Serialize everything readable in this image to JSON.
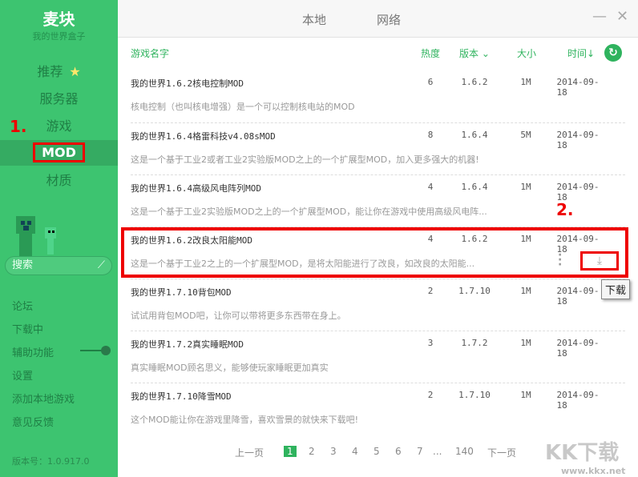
{
  "sidebar": {
    "logo": "麦块",
    "subtitle": "我的世界盒子",
    "nav": [
      "推荐",
      "服务器",
      "游戏",
      "MOD",
      "材质"
    ],
    "annotation1": "1.",
    "search_placeholder": "搜索",
    "links": [
      "论坛",
      "下载中",
      "辅助功能",
      "设置",
      "添加本地游戏",
      "意见反馈"
    ],
    "version": "版本号：1.0.917.0"
  },
  "tabs": [
    "本地",
    "网络"
  ],
  "columns": {
    "name": "游戏名字",
    "heat": "热度",
    "version": "版本",
    "size": "大小",
    "time": "时间"
  },
  "rows": [
    {
      "title": "我的世界1.6.2核电控制MOD",
      "desc": "核电控制（也叫核电增强）是一个可以控制核电站的MOD",
      "heat": "6",
      "version": "1.6.2",
      "size": "1M",
      "date": "2014-09-18"
    },
    {
      "title": "我的世界1.6.4格雷科技v4.08sMOD",
      "desc": "这是一个基于工业2或者工业2实验版MOD之上的一个扩展型MOD，加入更多强大的机器!",
      "heat": "8",
      "version": "1.6.4",
      "size": "5M",
      "date": "2014-09-18"
    },
    {
      "title": "我的世界1.6.4高级风电阵列MOD",
      "desc": "这是一个基于工业2实验版MOD之上的一个扩展型MOD，能让你在游戏中使用高级风电阵...",
      "heat": "4",
      "version": "1.6.4",
      "size": "1M",
      "date": "2014-09-18"
    },
    {
      "title": "我的世界1.6.2改良太阳能MOD",
      "desc": "这是一个基于工业2之上的一个扩展型MOD，是将太阳能进行了改良，如改良的太阳能...",
      "heat": "4",
      "version": "1.6.2",
      "size": "1M",
      "date": "2014-09-18"
    },
    {
      "title": "我的世界1.7.10背包MOD",
      "desc": "试试用背包MOD吧，让你可以带将更多东西带在身上。",
      "heat": "2",
      "version": "1.7.10",
      "size": "1M",
      "date": "2014-09-18"
    },
    {
      "title": "我的世界1.7.2真实睡眠MOD",
      "desc": "真实睡眠MOD顾名思义，能够使玩家睡眠更加真实",
      "heat": "3",
      "version": "1.7.2",
      "size": "1M",
      "date": "2014-09-18"
    },
    {
      "title": "我的世界1.7.10降雪MOD",
      "desc": "这个MOD能让你在游戏里降雪，喜欢雪景的就快来下载吧!",
      "heat": "2",
      "version": "1.7.10",
      "size": "1M",
      "date": "2014-09-18"
    }
  ],
  "annotation2": "2.",
  "tooltip": "下载",
  "pagination": {
    "prev": "上一页",
    "pages": [
      "1",
      "2",
      "3",
      "4",
      "5",
      "6",
      "7",
      "...",
      "140"
    ],
    "next": "下一页"
  },
  "watermark": {
    "logo": "KK下载",
    "url": "www.kkx.net"
  }
}
